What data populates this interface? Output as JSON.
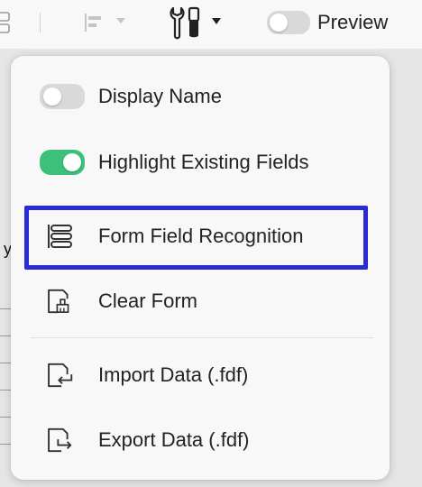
{
  "toolbar": {
    "preview_label": "Preview",
    "preview_enabled": false,
    "icons": [
      "panel-toggle-icon",
      "align-left-icon",
      "chevron-down-icon",
      "tools-icon",
      "chevron-down-icon"
    ]
  },
  "document": {
    "partial_text": "y"
  },
  "menu": {
    "items": [
      {
        "label": "Display Name",
        "type": "toggle",
        "enabled": false,
        "icon": "toggle-off"
      },
      {
        "label": "Highlight Existing Fields",
        "type": "toggle",
        "enabled": true,
        "icon": "toggle-on"
      },
      {
        "label": "Form Field Recognition",
        "type": "action",
        "icon": "form-fields-icon",
        "highlighted": true
      },
      {
        "label": "Clear Form",
        "type": "action",
        "icon": "clear-form-icon"
      },
      {
        "label": "Import Data (.fdf)",
        "type": "action",
        "icon": "import-data-icon"
      },
      {
        "label": "Export Data (.fdf)",
        "type": "action",
        "icon": "export-data-icon"
      }
    ]
  },
  "colors": {
    "toggle_on": "#3cc07a",
    "toggle_off": "#d9d9d9",
    "highlight_border": "#2a2ad6",
    "menu_background": "#f8f8f8"
  }
}
